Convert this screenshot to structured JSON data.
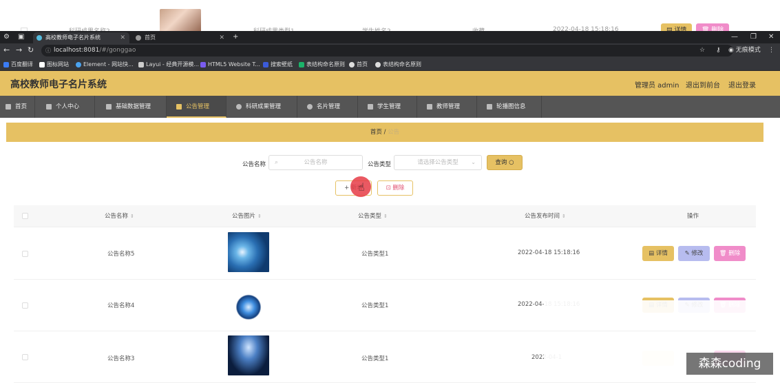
{
  "ghost_row": {
    "name": "科研成果名称2",
    "type": "科研成果类型1",
    "student": "学生姓名2",
    "category": "收藏",
    "time": "2022-04-18 15:18:16",
    "detail": "详情",
    "delete": "删除"
  },
  "browser": {
    "tabs": [
      {
        "label": "高校教师电子名片系统",
        "active": true
      },
      {
        "label": "首页",
        "active": false
      }
    ],
    "new_tab": "+",
    "url_host": "localhost:8081",
    "url_path": "/#/gonggao",
    "incognito": "无痕模式",
    "bookmarks": [
      {
        "label": "百度翻译",
        "color": "#3b7cf4"
      },
      {
        "label": "图标网站",
        "color": "#ffffff"
      },
      {
        "label": "Element - 网站快...",
        "color": "#4aa3f0"
      },
      {
        "label": "Layui - 经典开源模...",
        "color": "#cccccc"
      },
      {
        "label": "HTML5 Website T...",
        "color": "#7a5cf0"
      },
      {
        "label": "搜索壁纸",
        "color": "#3b5bd9"
      },
      {
        "label": "表结构命名原则",
        "color": "#1bb36a"
      },
      {
        "label": "首页",
        "color": "#dddddd"
      },
      {
        "label": "表结构命名原则",
        "color": "#dddddd"
      }
    ]
  },
  "header": {
    "title": "高校教师电子名片系统",
    "user": "管理员 admin",
    "to_front": "退出到前台",
    "logout": "退出登录"
  },
  "nav": [
    {
      "label": "首页",
      "caret": false,
      "active": false
    },
    {
      "label": "个人中心",
      "caret": false,
      "active": false
    },
    {
      "label": "基础数据管理",
      "caret": false,
      "active": false
    },
    {
      "label": "公告管理",
      "caret": false,
      "active": true
    },
    {
      "label": "科研成果管理",
      "caret": false,
      "active": false
    },
    {
      "label": "名片管理",
      "caret": false,
      "active": false
    },
    {
      "label": "学生管理",
      "caret": false,
      "active": false
    },
    {
      "label": "教师管理",
      "caret": false,
      "active": false
    },
    {
      "label": "轮播图信息",
      "caret": false,
      "active": false
    }
  ],
  "breadcrumb": {
    "home": "首页",
    "sep": "/",
    "current": "公告"
  },
  "search": {
    "name_label": "公告名称",
    "name_placeholder": "公告名称",
    "type_label": "公告类型",
    "type_placeholder": "请选择公告类型",
    "query_label": "查询"
  },
  "actions": {
    "add": "新增",
    "delete": "删除"
  },
  "table": {
    "columns": [
      "公告名称",
      "公告图片",
      "公告类型",
      "公告发布时间",
      "操作"
    ],
    "rows": [
      {
        "name": "公告名称5",
        "type": "公告类型1",
        "time": "2022-04-18 15:18:16"
      },
      {
        "name": "公告名称4",
        "type": "公告类型1",
        "time": "2022-04-18 15:18:16"
      },
      {
        "name": "公告名称3",
        "type": "公告类型1",
        "time": "2022-04-1"
      }
    ],
    "row_buttons": {
      "detail": "详情",
      "edit": "修改",
      "delete": "删除"
    }
  },
  "watermark": "森森coding",
  "colors": {
    "accent": "#e6c163",
    "nav_bg": "#555555",
    "edit": "#b7bcef",
    "delete": "#f08cc9"
  }
}
